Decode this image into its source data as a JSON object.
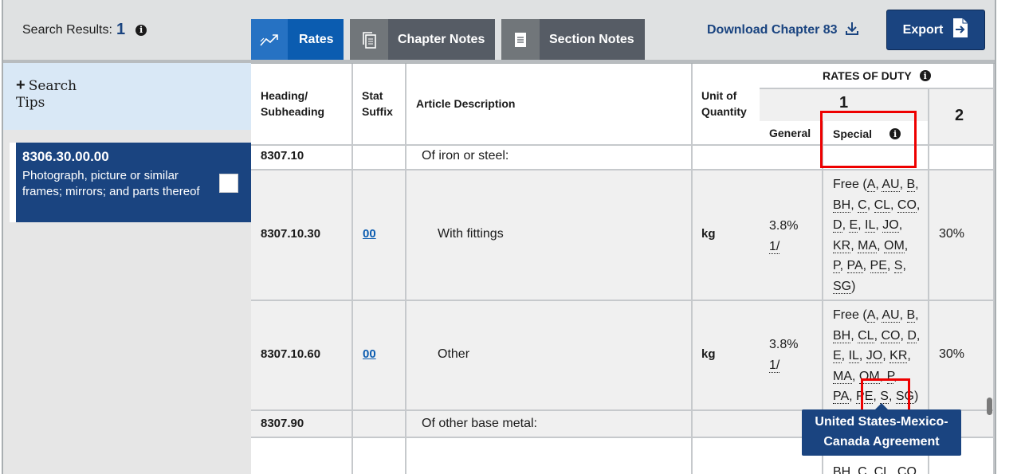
{
  "header": {
    "search_results_label": "Search Results:",
    "search_results_count": "1",
    "tabs": [
      {
        "label": "Rates",
        "icon": "trend-chart-icon",
        "active": true
      },
      {
        "label": "Chapter Notes",
        "icon": "documents-icon",
        "active": false
      },
      {
        "label": "Section Notes",
        "icon": "document-icon",
        "active": false
      }
    ],
    "download_label": "Download Chapter 83",
    "export_label": "Export"
  },
  "sidebar": {
    "tips_label_1": "Search",
    "tips_label_2": "Tips",
    "card": {
      "code": "8306.30.00.00",
      "description": "Photograph, picture or similar frames; mirrors; and parts thereof"
    }
  },
  "table": {
    "headers": {
      "heading": "Heading/\nSubheading",
      "heading_1": "Heading/",
      "heading_2": "Subheading",
      "stat_1": "Stat",
      "stat_2": "Suffix",
      "description": "Article Description",
      "unit_1": "Unit of",
      "unit_2": "Quantity",
      "rates_of_duty": "RATES OF DUTY",
      "column1": "1",
      "column2": "2",
      "general": "General",
      "special": "Special"
    },
    "rows": [
      {
        "heading": "8307.10",
        "stat": "",
        "description": "Of iron or steel:",
        "unit": "",
        "general": "",
        "special": "",
        "col2": ""
      },
      {
        "heading": "8307.10.30",
        "stat": "00",
        "description": "With fittings",
        "unit": "kg",
        "general_1": "3.8%",
        "general_2": "1/",
        "special_lines": [
          "Free (A, AU, B,",
          "BH, C, CL, CO,",
          "D, E, IL, JO,",
          "KR, MA, OM,",
          "P, PA, PE, S,",
          "SG)"
        ],
        "col2": "30%"
      },
      {
        "heading": "8307.10.60",
        "stat": "00",
        "description": "Other",
        "unit": "kg",
        "general_1": "3.8%",
        "general_2": "1/",
        "special_lines": [
          "Free (A, AU, B,",
          "BH, CL, CO, D,",
          "E, IL, JO, KR,",
          "MA, OM, P,",
          "PA, PE, S, SG)"
        ],
        "col2": "30%"
      },
      {
        "heading": "8307.90",
        "stat": "",
        "description": "Of other base metal:",
        "unit": "",
        "general": "",
        "special": "",
        "col2": ""
      },
      {
        "heading": "",
        "stat": "",
        "description": "",
        "unit": "",
        "special_lines": [
          "BH, C, CL, CO,"
        ],
        "col2": ""
      }
    ]
  },
  "tooltip": {
    "text": "United States-Mexico-Canada Agreement"
  }
}
